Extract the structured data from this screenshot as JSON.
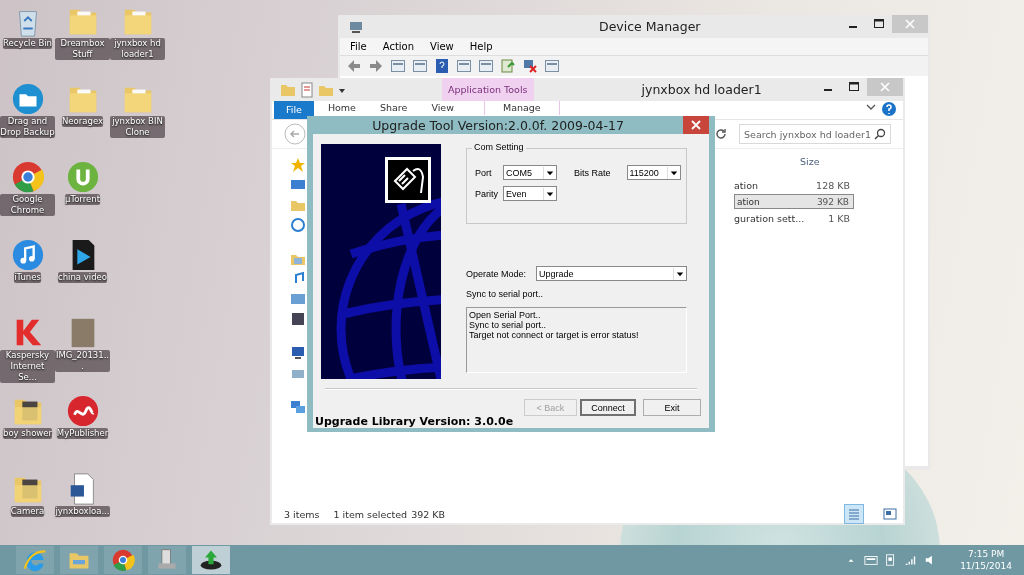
{
  "desktop_icons": [
    {
      "label": "Recycle Bin",
      "kind": "recycle"
    },
    {
      "label": "Drag and Drop Backup",
      "kind": "backup"
    },
    {
      "label": "Google Chrome",
      "kind": "chrome"
    },
    {
      "label": "iTunes",
      "kind": "itunes"
    },
    {
      "label": "Kaspersky Internet Se...",
      "kind": "kaspersky"
    },
    {
      "label": "boy shower",
      "kind": "photofolder"
    },
    {
      "label": "Camera",
      "kind": "photofolder"
    },
    {
      "label": "Dreambox Stuff",
      "kind": "folder"
    },
    {
      "label": "Neoragex",
      "kind": "folder"
    },
    {
      "label": "µTorrent",
      "kind": "torrent"
    },
    {
      "label": "china video",
      "kind": "video"
    },
    {
      "label": "IMG_20131...",
      "kind": "photo"
    },
    {
      "label": "MyPublisher",
      "kind": "mypublisher"
    },
    {
      "label": "jynxboxloa...",
      "kind": "doc"
    },
    {
      "label": "jynxbox hd loader1",
      "kind": "folder"
    },
    {
      "label": "jynxbox BIN Clone",
      "kind": "folder"
    }
  ],
  "device_manager": {
    "title": "Device Manager",
    "menu": [
      "File",
      "Action",
      "View",
      "Help"
    ]
  },
  "explorer": {
    "title": "jynxbox hd loader1",
    "context_group": "Application Tools",
    "ribbon_tabs": [
      {
        "label": "File",
        "kind": "file"
      },
      {
        "label": "Home",
        "kind": "tab"
      },
      {
        "label": "Share",
        "kind": "tab"
      },
      {
        "label": "View",
        "kind": "tab"
      },
      {
        "label": "Manage",
        "kind": "context"
      }
    ],
    "search": {
      "placeholder": "Search jynxbox hd loader1"
    },
    "size_column": "Size",
    "rows": [
      {
        "name": "ation",
        "size": "128 KB",
        "selected": false
      },
      {
        "name": "ation",
        "size": "392 KB",
        "selected": true
      },
      {
        "name": "guration sett...",
        "size": "1 KB",
        "selected": false
      }
    ],
    "status": {
      "count": "3 items",
      "selection": "1 item selected",
      "size": "392 KB"
    }
  },
  "dialog": {
    "title": "Upgrade Tool Version:2.0.0f. 2009-04-17",
    "group_title": "Com Setting",
    "port": {
      "label": "Port",
      "value": "COM5"
    },
    "bits_rate": {
      "label": "Bits Rate",
      "value": "115200"
    },
    "parity": {
      "label": "Parity",
      "value": "Even"
    },
    "operate_mode": {
      "label": "Operate Mode:",
      "value": "Upgrade"
    },
    "status_text": "Sync to serial port..",
    "log": [
      "Open Serial Port..",
      "Sync to serial port..",
      "Target not connect or target is error status!"
    ],
    "buttons": [
      {
        "label": "< Back",
        "disabled": true,
        "default": false
      },
      {
        "label": "Connect",
        "disabled": false,
        "default": true
      },
      {
        "label": "Exit",
        "disabled": false,
        "default": false
      }
    ],
    "footer": "Upgrade Library Version: 3.0.0e"
  },
  "taskbar": {
    "apps": [
      {
        "kind": "ie",
        "selected": false
      },
      {
        "kind": "explorer",
        "selected": false
      },
      {
        "kind": "chrome",
        "selected": false
      },
      {
        "kind": "devices",
        "selected": false
      },
      {
        "kind": "upgrade",
        "selected": true
      }
    ],
    "time": "7:15 PM",
    "date": "11/15/2014"
  }
}
